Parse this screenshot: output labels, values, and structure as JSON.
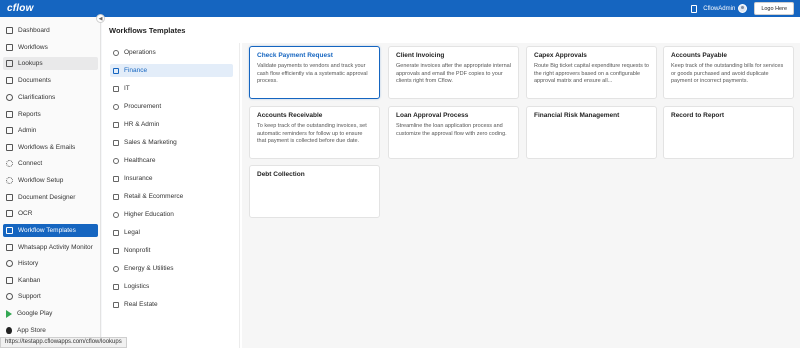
{
  "header": {
    "logo": "cflow",
    "username": "CflowAdmin",
    "logout_label": "Logo Here"
  },
  "sidebar": {
    "items": [
      {
        "label": "Dashboard",
        "icon": "dashboard-icon"
      },
      {
        "label": "Workflows",
        "icon": "workflows-icon"
      },
      {
        "label": "Lookups",
        "icon": "lookups-icon"
      },
      {
        "label": "Documents",
        "icon": "documents-icon"
      },
      {
        "label": "Clarifications",
        "icon": "clarifications-icon"
      },
      {
        "label": "Reports",
        "icon": "reports-icon"
      },
      {
        "label": "Admin",
        "icon": "admin-icon"
      },
      {
        "label": "Workflows & Emails",
        "icon": "mail-icon"
      },
      {
        "label": "Connect",
        "icon": "connect-icon"
      },
      {
        "label": "Workflow Setup",
        "icon": "setup-icon"
      },
      {
        "label": "Document Designer",
        "icon": "designer-icon"
      },
      {
        "label": "OCR",
        "icon": "ocr-icon"
      },
      {
        "label": "Workflow Templates",
        "icon": "templates-icon"
      },
      {
        "label": "Whatsapp Activity Monitor",
        "icon": "whatsapp-icon"
      },
      {
        "label": "History",
        "icon": "history-icon"
      },
      {
        "label": "Kanban",
        "icon": "kanban-icon"
      },
      {
        "label": "Support",
        "icon": "support-icon"
      },
      {
        "label": "Google Play",
        "icon": "google-play-icon"
      },
      {
        "label": "App Store",
        "icon": "apple-icon"
      }
    ],
    "active_index": 12,
    "hover_index": 2
  },
  "page": {
    "title": "Workflows Templates"
  },
  "categories": {
    "items": [
      "Operations",
      "Finance",
      "IT",
      "Procurement",
      "HR & Admin",
      "Sales & Marketing",
      "Healthcare",
      "Insurance",
      "Retail & Ecommerce",
      "Higher Education",
      "Legal",
      "Nonprofit",
      "Energy & Utilities",
      "Logistics",
      "Real Estate"
    ],
    "active_index": 1
  },
  "cards": [
    {
      "title": "Check Payment Request",
      "desc": "Validate payments to vendors and track your cash flow efficiently via a systematic approval process."
    },
    {
      "title": "Client Invoicing",
      "desc": "Generate invoices after the appropriate internal approvals and email the PDF copies to your clients right from Cflow."
    },
    {
      "title": "Capex Approvals",
      "desc": "Route Big ticket capital expenditure requests to the right approvers based on a configurable approval matrix and ensure all..."
    },
    {
      "title": "Accounts Payable",
      "desc": "Keep track of the outstanding bills for services or goods purchased and avoid duplicate payment or incorrect payments."
    },
    {
      "title": "Accounts Receivable",
      "desc": "To keep track of the outstanding invoices, set automatic reminders for follow up to ensure that payment is collected before due date."
    },
    {
      "title": "Loan Approval Process",
      "desc": "Streamline the loan application process and customize the approval flow with zero coding."
    },
    {
      "title": "Financial Risk Management",
      "desc": ""
    },
    {
      "title": "Record to Report",
      "desc": ""
    },
    {
      "title": "Debt Collection",
      "desc": ""
    }
  ],
  "statusbar": {
    "url": "https://testapp.cflowapps.com/cflow/lookups"
  }
}
